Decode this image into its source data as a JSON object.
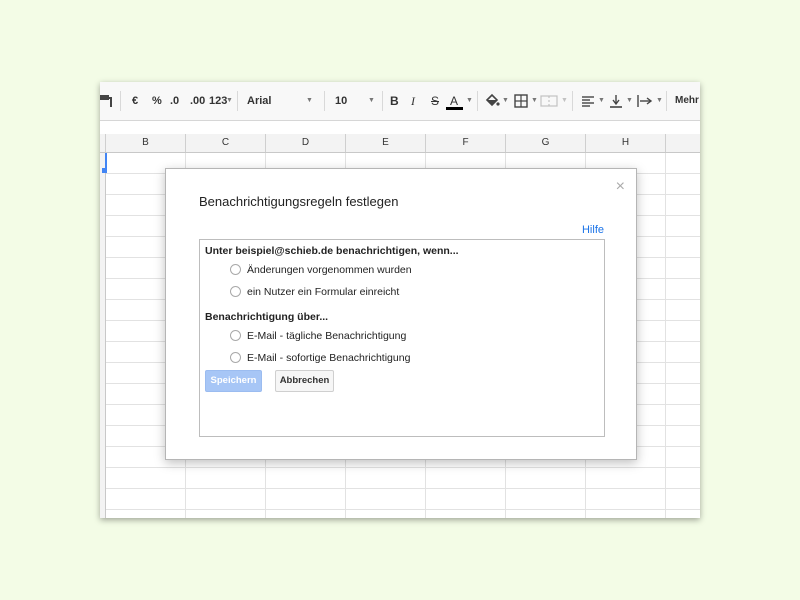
{
  "toolbar": {
    "currency": "€",
    "percent": "%",
    "dec_decrease": ".0",
    "dec_increase": ".00",
    "number_format": "123",
    "font_family": "Arial",
    "font_size": "10",
    "bold": "B",
    "italic": "I",
    "strikethrough": "S",
    "text_color": "A",
    "more": "Mehr",
    "icons": [
      "paint-format-icon",
      "fill-color-icon",
      "borders-icon",
      "merge-cells-icon",
      "align-left-icon",
      "valign-bottom-icon",
      "text-wrap-icon"
    ]
  },
  "grid": {
    "columns": [
      "B",
      "C",
      "D",
      "E",
      "F",
      "G",
      "H"
    ]
  },
  "dialog": {
    "title": "Benachrichtigungsregeln festlegen",
    "close": "×",
    "help": "Hilfe",
    "section1_label": "Unter beispiel@schieb.de benachrichtigen, wenn...",
    "section1_options": [
      "Änderungen vorgenommen wurden",
      "ein Nutzer ein Formular einreicht"
    ],
    "section2_label": "Benachrichtigung über...",
    "section2_options": [
      "E-Mail - tägliche Benachrichtigung",
      "E-Mail - sofortige Benachrichtigung"
    ],
    "save_label": "Speichern",
    "cancel_label": "Abbrechen"
  },
  "colors": {
    "background": "#f3fce6",
    "accent": "#4285f4",
    "link": "#1a73e8",
    "save_disabled": "#a7c6f6"
  }
}
